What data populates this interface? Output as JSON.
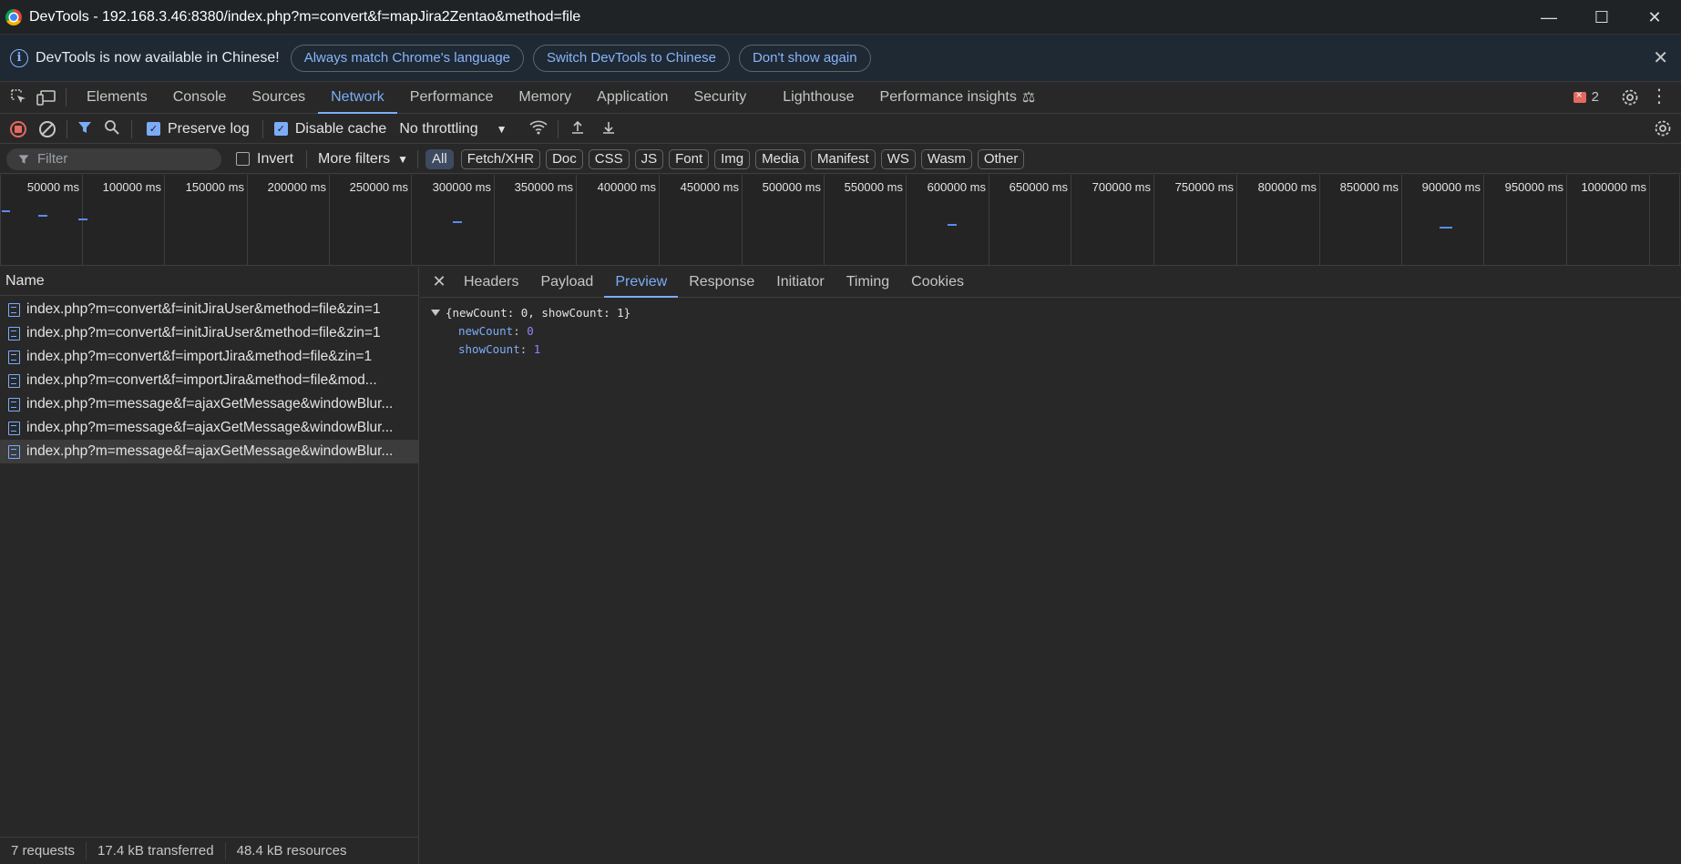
{
  "window": {
    "title": "DevTools - 192.168.3.46:8380/index.php?m=convert&f=mapJira2Zentao&method=file",
    "minimize_icon": "minimize-icon",
    "maximize_icon": "maximize-icon",
    "close_icon": "close-icon"
  },
  "infobar": {
    "message": "DevTools is now available in Chinese!",
    "btn_match": "Always match Chrome's language",
    "btn_switch": "Switch DevTools to Chinese",
    "btn_dont_show": "Don't show again"
  },
  "tabs": [
    "Elements",
    "Console",
    "Sources",
    "Network",
    "Performance",
    "Memory",
    "Application",
    "Security",
    "Lighthouse",
    "Performance insights"
  ],
  "active_tab": "Network",
  "error_count": "2",
  "network_toolbar": {
    "preserve_log": "Preserve log",
    "disable_cache": "Disable cache",
    "throttling": "No throttling"
  },
  "filterbar": {
    "placeholder": "Filter",
    "invert": "Invert",
    "more_filters": "More filters",
    "chips": [
      "All",
      "Fetch/XHR",
      "Doc",
      "CSS",
      "JS",
      "Font",
      "Img",
      "Media",
      "Manifest",
      "WS",
      "Wasm",
      "Other"
    ]
  },
  "overview": {
    "ticks": [
      "50000 ms",
      "100000 ms",
      "150000 ms",
      "200000 ms",
      "250000 ms",
      "300000 ms",
      "350000 ms",
      "400000 ms",
      "450000 ms",
      "500000 ms",
      "550000 ms",
      "600000 ms",
      "650000 ms",
      "700000 ms",
      "750000 ms",
      "800000 ms",
      "850000 ms",
      "900000 ms",
      "950000 ms",
      "1000000 ms"
    ]
  },
  "requests": {
    "header": "Name",
    "rows": [
      "index.php?m=convert&f=initJiraUser&method=file&zin=1",
      "index.php?m=convert&f=initJiraUser&method=file&zin=1",
      "index.php?m=convert&f=importJira&method=file&zin=1",
      "index.php?m=convert&f=importJira&method=file&mod...",
      "index.php?m=message&f=ajaxGetMessage&windowBlur...",
      "index.php?m=message&f=ajaxGetMessage&windowBlur...",
      "index.php?m=message&f=ajaxGetMessage&windowBlur..."
    ],
    "selected_index": 6
  },
  "status": {
    "requests": "7 requests",
    "transferred": "17.4 kB transferred",
    "resources": "48.4 kB resources"
  },
  "detail": {
    "tabs": [
      "Headers",
      "Payload",
      "Preview",
      "Response",
      "Initiator",
      "Timing",
      "Cookies"
    ],
    "active": "Preview",
    "preview_root": "{newCount: 0, showCount: 1}",
    "fields": [
      {
        "key": "newCount",
        "value": "0"
      },
      {
        "key": "showCount",
        "value": "1"
      }
    ]
  }
}
